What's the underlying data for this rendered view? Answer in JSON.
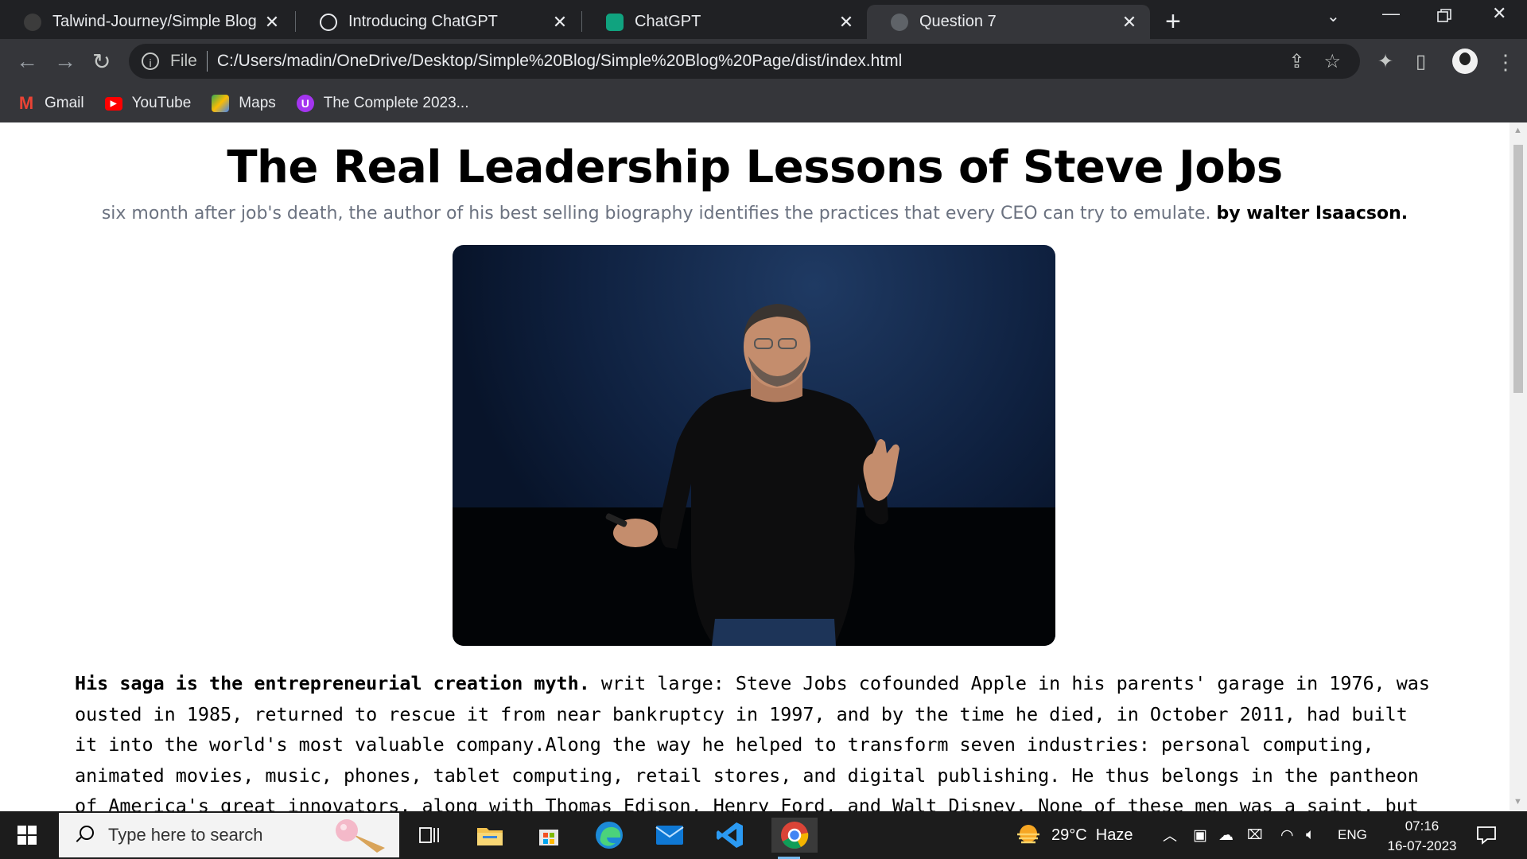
{
  "browser": {
    "tabs": [
      {
        "title": "Talwind-Journey/Simple Blog Pag",
        "icon": "github-icon",
        "active": false
      },
      {
        "title": "Introducing ChatGPT",
        "icon": "openai-icon",
        "active": false
      },
      {
        "title": "ChatGPT",
        "icon": "chatgpt-icon",
        "active": false
      },
      {
        "title": "Question 7",
        "icon": "globe-icon",
        "active": true
      }
    ],
    "address": {
      "scheme_label": "File",
      "url": "C:/Users/madin/OneDrive/Desktop/Simple%20Blog/Simple%20Blog%20Page/dist/index.html"
    },
    "bookmarks": [
      {
        "label": "Gmail",
        "icon": "gmail-icon",
        "color": "#ea4335"
      },
      {
        "label": "YouTube",
        "icon": "youtube-icon",
        "color": "#ff0000"
      },
      {
        "label": "Maps",
        "icon": "maps-icon",
        "color": "#34a853"
      },
      {
        "label": "The Complete 2023...",
        "icon": "udemy-icon",
        "color": "#a435f0"
      }
    ]
  },
  "article": {
    "title": "The Real Leadership Lessons of Steve Jobs",
    "subtitle": "six month after job's death, the author of his best selling biography identifies the practices that every CEO can try to emulate.",
    "author": "by walter Isaacson.",
    "lead": "His saga is the entrepreneurial creation myth.",
    "body": " writ large: Steve Jobs cofounded Apple in his parents' garage in 1976, was ousted in 1985, returned to rescue it from near bankruptcy in 1997, and by the time he died, in October 2011, had built it into the world's most valuable company.Along the way he helped to transform seven industries: personal computing, animated movies, music, phones, tablet computing, retail stores, and digital publishing. He thus belongs in the pantheon of America's great innovators, along with Thomas Edison, Henry Ford, and Walt Disney. None of these men was a saint, but"
  },
  "taskbar": {
    "search_placeholder": "Type here to search",
    "weather": "29°C  Haze",
    "language": "ENG",
    "time": "07:16",
    "date": "16-07-2023"
  },
  "colors": {
    "accent": "#76b9ed",
    "chrome_dark": "#202124",
    "chrome_toolbar": "#35363a"
  }
}
